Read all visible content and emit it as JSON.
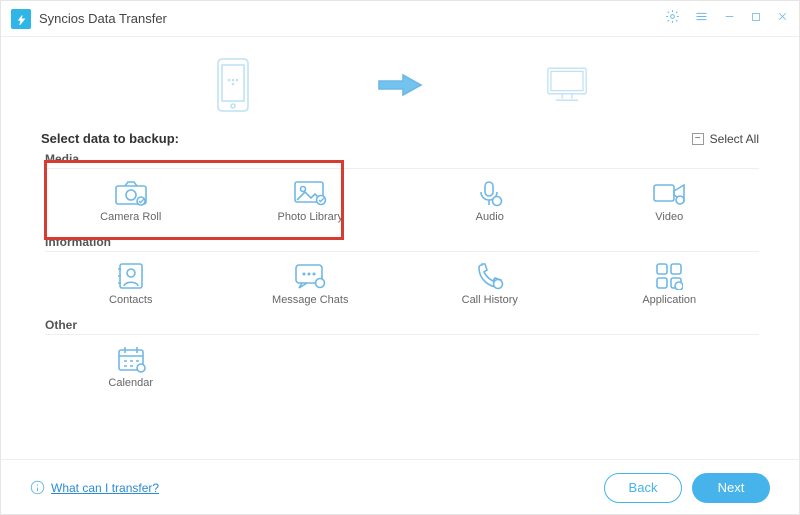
{
  "app": {
    "title": "Syncios Data Transfer"
  },
  "header": {
    "select_label": "Select data to backup:",
    "select_all": "Select All"
  },
  "groups": {
    "media": {
      "label": "Media",
      "items": [
        {
          "name": "camera-roll",
          "label": "Camera Roll",
          "checked": true
        },
        {
          "name": "photo-library",
          "label": "Photo Library",
          "checked": true
        },
        {
          "name": "audio",
          "label": "Audio",
          "checked": false
        },
        {
          "name": "video",
          "label": "Video",
          "checked": false
        }
      ]
    },
    "information": {
      "label": "Information",
      "items": [
        {
          "name": "contacts",
          "label": "Contacts"
        },
        {
          "name": "message-chats",
          "label": "Message Chats"
        },
        {
          "name": "call-history",
          "label": "Call History"
        },
        {
          "name": "application",
          "label": "Application"
        }
      ]
    },
    "other": {
      "label": "Other",
      "items": [
        {
          "name": "calendar",
          "label": "Calendar"
        }
      ]
    }
  },
  "footer": {
    "help_text": "What can I transfer?",
    "back": "Back",
    "next": "Next"
  }
}
